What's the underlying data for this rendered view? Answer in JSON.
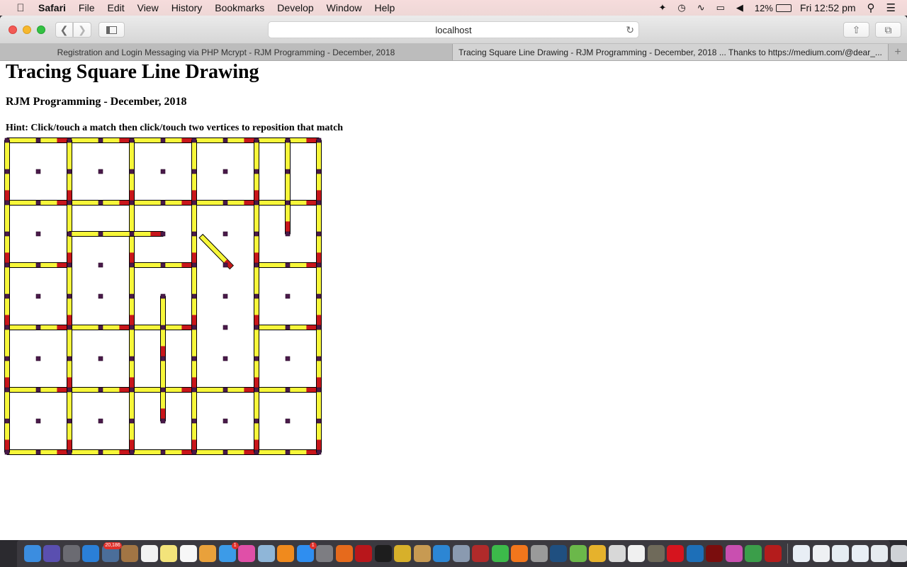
{
  "menubar": {
    "app_name": "Safari",
    "menus": [
      "File",
      "Edit",
      "View",
      "History",
      "Bookmarks",
      "Develop",
      "Window",
      "Help"
    ],
    "status": {
      "battery": "12%",
      "clock": "Fri 12:52 pm"
    }
  },
  "browser": {
    "address": "localhost",
    "tabs": [
      {
        "label": "Registration and Login Messaging via PHP Mcrypt - RJM Programming - December, 2018",
        "active": false
      },
      {
        "label": "Tracing Square Line Drawing - RJM Programming - December, 2018 ... Thanks to https://medium.com/@dear_...",
        "active": true
      }
    ],
    "new_tab_label": "+"
  },
  "page": {
    "title": "Tracing Square Line Drawing",
    "subtitle": "RJM Programming - December, 2018",
    "hint": "Hint: Click/touch a match then click/touch two vertices to reposition that match"
  },
  "board": {
    "grid_vertices_per_side": 11,
    "square_span": 2,
    "colors": {
      "match_body": "#f7f73a",
      "match_head": "#c8161b",
      "outline": "#000000",
      "vertex": "#4a1a4a"
    },
    "matches": [
      {
        "from": [
          0,
          0
        ],
        "to": [
          2,
          0
        ]
      },
      {
        "from": [
          2,
          0
        ],
        "to": [
          4,
          0
        ]
      },
      {
        "from": [
          4,
          0
        ],
        "to": [
          6,
          0
        ]
      },
      {
        "from": [
          6,
          0
        ],
        "to": [
          8,
          0
        ]
      },
      {
        "from": [
          8,
          0
        ],
        "to": [
          10,
          0
        ]
      },
      {
        "from": [
          0,
          2
        ],
        "to": [
          2,
          2
        ]
      },
      {
        "from": [
          2,
          2
        ],
        "to": [
          4,
          2
        ]
      },
      {
        "from": [
          4,
          2
        ],
        "to": [
          6,
          2
        ]
      },
      {
        "from": [
          6,
          2
        ],
        "to": [
          8,
          2
        ]
      },
      {
        "from": [
          8,
          2
        ],
        "to": [
          10,
          2
        ]
      },
      {
        "from": [
          0,
          4
        ],
        "to": [
          2,
          4
        ]
      },
      {
        "from": [
          4,
          4
        ],
        "to": [
          6,
          4
        ]
      },
      {
        "from": [
          8,
          4
        ],
        "to": [
          10,
          4
        ]
      },
      {
        "from": [
          0,
          6
        ],
        "to": [
          2,
          6
        ]
      },
      {
        "from": [
          2,
          6
        ],
        "to": [
          4,
          6
        ]
      },
      {
        "from": [
          4,
          6
        ],
        "to": [
          6,
          6
        ]
      },
      {
        "from": [
          8,
          6
        ],
        "to": [
          10,
          6
        ]
      },
      {
        "from": [
          0,
          8
        ],
        "to": [
          2,
          8
        ]
      },
      {
        "from": [
          2,
          8
        ],
        "to": [
          4,
          8
        ]
      },
      {
        "from": [
          4,
          8
        ],
        "to": [
          6,
          8
        ]
      },
      {
        "from": [
          6,
          8
        ],
        "to": [
          8,
          8
        ]
      },
      {
        "from": [
          8,
          8
        ],
        "to": [
          10,
          8
        ]
      },
      {
        "from": [
          0,
          10
        ],
        "to": [
          2,
          10
        ]
      },
      {
        "from": [
          2,
          10
        ],
        "to": [
          4,
          10
        ]
      },
      {
        "from": [
          4,
          10
        ],
        "to": [
          6,
          10
        ]
      },
      {
        "from": [
          6,
          10
        ],
        "to": [
          8,
          10
        ]
      },
      {
        "from": [
          8,
          10
        ],
        "to": [
          10,
          10
        ]
      },
      {
        "from": [
          0,
          0
        ],
        "to": [
          0,
          2
        ]
      },
      {
        "from": [
          2,
          0
        ],
        "to": [
          2,
          2
        ]
      },
      {
        "from": [
          4,
          0
        ],
        "to": [
          4,
          2
        ]
      },
      {
        "from": [
          6,
          0
        ],
        "to": [
          6,
          2
        ]
      },
      {
        "from": [
          8,
          0
        ],
        "to": [
          8,
          2
        ]
      },
      {
        "from": [
          10,
          0
        ],
        "to": [
          10,
          2
        ]
      },
      {
        "from": [
          0,
          2
        ],
        "to": [
          0,
          4
        ]
      },
      {
        "from": [
          2,
          2
        ],
        "to": [
          2,
          4
        ]
      },
      {
        "from": [
          4,
          2
        ],
        "to": [
          4,
          4
        ]
      },
      {
        "from": [
          6,
          2
        ],
        "to": [
          6,
          4
        ]
      },
      {
        "from": [
          8,
          2
        ],
        "to": [
          8,
          4
        ]
      },
      {
        "from": [
          10,
          2
        ],
        "to": [
          10,
          4
        ]
      },
      {
        "from": [
          0,
          4
        ],
        "to": [
          0,
          6
        ]
      },
      {
        "from": [
          2,
          4
        ],
        "to": [
          2,
          6
        ]
      },
      {
        "from": [
          4,
          4
        ],
        "to": [
          4,
          6
        ]
      },
      {
        "from": [
          6,
          4
        ],
        "to": [
          6,
          6
        ]
      },
      {
        "from": [
          8,
          4
        ],
        "to": [
          8,
          6
        ]
      },
      {
        "from": [
          10,
          4
        ],
        "to": [
          10,
          6
        ]
      },
      {
        "from": [
          0,
          6
        ],
        "to": [
          0,
          8
        ]
      },
      {
        "from": [
          2,
          6
        ],
        "to": [
          2,
          8
        ]
      },
      {
        "from": [
          4,
          6
        ],
        "to": [
          4,
          8
        ]
      },
      {
        "from": [
          6,
          6
        ],
        "to": [
          6,
          8
        ]
      },
      {
        "from": [
          8,
          6
        ],
        "to": [
          8,
          8
        ]
      },
      {
        "from": [
          10,
          6
        ],
        "to": [
          10,
          8
        ]
      },
      {
        "from": [
          0,
          8
        ],
        "to": [
          0,
          10
        ]
      },
      {
        "from": [
          2,
          8
        ],
        "to": [
          2,
          10
        ]
      },
      {
        "from": [
          4,
          8
        ],
        "to": [
          4,
          10
        ]
      },
      {
        "from": [
          6,
          8
        ],
        "to": [
          6,
          10
        ]
      },
      {
        "from": [
          8,
          8
        ],
        "to": [
          8,
          10
        ]
      },
      {
        "from": [
          10,
          8
        ],
        "to": [
          10,
          10
        ]
      },
      {
        "from": [
          2,
          3
        ],
        "to": [
          4,
          3
        ]
      },
      {
        "from": [
          3,
          3
        ],
        "to": [
          5,
          3
        ]
      },
      {
        "from": [
          9,
          0
        ],
        "to": [
          9,
          2
        ]
      },
      {
        "from": [
          9,
          1
        ],
        "to": [
          9,
          3
        ]
      },
      {
        "from": [
          5,
          5
        ],
        "to": [
          5,
          7
        ]
      },
      {
        "from": [
          5,
          7
        ],
        "to": [
          5,
          9
        ]
      },
      {
        "from": [
          6.22,
          3.07
        ],
        "to": [
          7.2,
          4.07
        ]
      }
    ]
  },
  "dock": {
    "apps": [
      {
        "name": "finder",
        "color": "#3b8de0"
      },
      {
        "name": "siri",
        "color": "#5a4fb0"
      },
      {
        "name": "launchpad",
        "color": "#6b6b72"
      },
      {
        "name": "safari",
        "color": "#2a7fd8"
      },
      {
        "name": "mail-photo",
        "color": "#4b6e9a",
        "badge": "20,186"
      },
      {
        "name": "contacts",
        "color": "#a27544"
      },
      {
        "name": "calendar",
        "color": "#f2f2f2"
      },
      {
        "name": "notes",
        "color": "#f3e37a"
      },
      {
        "name": "reminders",
        "color": "#f7f7f7"
      },
      {
        "name": "photos",
        "color": "#e9a13b"
      },
      {
        "name": "messages",
        "color": "#3c9be8",
        "badge": "1"
      },
      {
        "name": "itunes",
        "color": "#e04fa8"
      },
      {
        "name": "preview",
        "color": "#8fb6d8"
      },
      {
        "name": "ibooks",
        "color": "#f08a1d"
      },
      {
        "name": "app-store",
        "color": "#2f8ef0",
        "badge": "1"
      },
      {
        "name": "system-preferences",
        "color": "#7d7d82"
      },
      {
        "name": "firefox",
        "color": "#e66a1c"
      },
      {
        "name": "filezilla",
        "color": "#b8161b"
      },
      {
        "name": "terminal",
        "color": "#1d1d1d"
      },
      {
        "name": "wireshark",
        "color": "#d7b02a"
      },
      {
        "name": "script-editor",
        "color": "#c79a52"
      },
      {
        "name": "xcode",
        "color": "#2c86d4"
      },
      {
        "name": "image-capture",
        "color": "#8a9ab0"
      },
      {
        "name": "photo-booth",
        "color": "#b02a2a"
      },
      {
        "name": "facetime",
        "color": "#3cba4a"
      },
      {
        "name": "avast",
        "color": "#f2761c"
      },
      {
        "name": "grapher",
        "color": "#9a9a9a"
      },
      {
        "name": "quicktime",
        "color": "#1f4f80"
      },
      {
        "name": "android-studio",
        "color": "#6bb84a"
      },
      {
        "name": "android-studio-preview",
        "color": "#e6b22c"
      },
      {
        "name": "gimp-like",
        "color": "#d8d8d8"
      },
      {
        "name": "text-document",
        "color": "#f0f0f0"
      },
      {
        "name": "gimp",
        "color": "#6f6a5a"
      },
      {
        "name": "opera",
        "color": "#d6141e"
      },
      {
        "name": "vscode",
        "color": "#1d6fb8"
      },
      {
        "name": "acrobat",
        "color": "#7a0d0d"
      },
      {
        "name": "colour-app",
        "color": "#c94fb0"
      },
      {
        "name": "chrome",
        "color": "#3b9e4a"
      },
      {
        "name": "filemaker",
        "color": "#b41c1c"
      }
    ],
    "docs": [
      {
        "name": "recent-doc-1",
        "color": "#e8eef5"
      },
      {
        "name": "recent-doc-2",
        "color": "#eef0f3"
      },
      {
        "name": "recent-doc-3",
        "color": "#e5ecf2"
      },
      {
        "name": "recent-doc-4",
        "color": "#e8eef5"
      },
      {
        "name": "recent-doc-5",
        "color": "#e6ebf0"
      },
      {
        "name": "trash",
        "color": "#cfd2d6"
      }
    ]
  }
}
